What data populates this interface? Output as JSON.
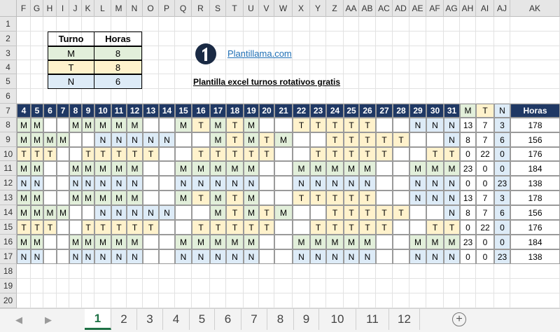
{
  "sheet": {
    "columns": [
      "F",
      "G",
      "H",
      "I",
      "J",
      "K",
      "L",
      "M",
      "N",
      "O",
      "P",
      "Q",
      "R",
      "S",
      "T",
      "U",
      "V",
      "W",
      "X",
      "Y",
      "Z",
      "AA",
      "AB",
      "AC",
      "AD",
      "AE",
      "AF",
      "AG",
      "AH",
      "AI",
      "AJ",
      "AK"
    ],
    "rows": [
      "1",
      "2",
      "3",
      "4",
      "5",
      "6",
      "7",
      "8",
      "9",
      "10",
      "11",
      "12",
      "13",
      "14",
      "15",
      "16",
      "17",
      "18",
      "19",
      "20"
    ]
  },
  "legend": {
    "header": [
      "Turno",
      "Horas"
    ],
    "rows": [
      {
        "turno": "M",
        "horas": "8"
      },
      {
        "turno": "T",
        "horas": "8"
      },
      {
        "turno": "N",
        "horas": "6"
      }
    ]
  },
  "logo_link": "Plantillama.com",
  "title": "Plantilla excel turnos rotativos gratis",
  "table": {
    "days": [
      "4",
      "5",
      "6",
      "7",
      "8",
      "9",
      "10",
      "11",
      "12",
      "13",
      "14",
      "15",
      "16",
      "17",
      "18",
      "19",
      "20",
      "21",
      "22",
      "23",
      "24",
      "25",
      "26",
      "27",
      "28",
      "29",
      "30",
      "31"
    ],
    "summary_headers": [
      "M",
      "T",
      "N",
      "Horas"
    ],
    "rows": [
      {
        "shifts": [
          "M",
          "M",
          "",
          "",
          "M",
          "M",
          "M",
          "M",
          "M",
          "",
          "",
          "M",
          "T",
          "M",
          "T",
          "M",
          "",
          "",
          "T",
          "T",
          "T",
          "T",
          "T",
          "",
          "",
          "N",
          "N",
          "N"
        ],
        "m": "13",
        "t": "7",
        "n": "3",
        "horas": "178"
      },
      {
        "shifts": [
          "M",
          "M",
          "M",
          "M",
          "",
          "",
          "N",
          "N",
          "N",
          "N",
          "N",
          "",
          "",
          "M",
          "T",
          "M",
          "T",
          "M",
          "",
          "",
          "T",
          "T",
          "T",
          "T",
          "T",
          "",
          "",
          "N"
        ],
        "m": "8",
        "t": "7",
        "n": "6",
        "horas": "156"
      },
      {
        "shifts": [
          "T",
          "T",
          "T",
          "",
          "",
          "T",
          "T",
          "T",
          "T",
          "T",
          "",
          "",
          "T",
          "T",
          "T",
          "T",
          "T",
          "",
          "",
          "T",
          "T",
          "T",
          "T",
          "T",
          "",
          "",
          "T",
          "T"
        ],
        "m": "0",
        "t": "22",
        "n": "0",
        "horas": "176"
      },
      {
        "shifts": [
          "M",
          "M",
          "",
          "",
          "M",
          "M",
          "M",
          "M",
          "M",
          "",
          "",
          "M",
          "M",
          "M",
          "M",
          "M",
          "",
          "",
          "M",
          "M",
          "M",
          "M",
          "M",
          "",
          "",
          "M",
          "M",
          "M"
        ],
        "m": "23",
        "t": "0",
        "n": "0",
        "horas": "184"
      },
      {
        "shifts": [
          "N",
          "N",
          "",
          "",
          "N",
          "N",
          "N",
          "N",
          "N",
          "",
          "",
          "N",
          "N",
          "N",
          "N",
          "N",
          "",
          "",
          "N",
          "N",
          "N",
          "N",
          "N",
          "",
          "",
          "N",
          "N",
          "N"
        ],
        "m": "0",
        "t": "0",
        "n": "23",
        "horas": "138"
      },
      {
        "shifts": [
          "M",
          "M",
          "",
          "",
          "M",
          "M",
          "M",
          "M",
          "M",
          "",
          "",
          "M",
          "T",
          "M",
          "T",
          "M",
          "",
          "",
          "T",
          "T",
          "T",
          "T",
          "T",
          "",
          "",
          "N",
          "N",
          "N"
        ],
        "m": "13",
        "t": "7",
        "n": "3",
        "horas": "178"
      },
      {
        "shifts": [
          "M",
          "M",
          "M",
          "M",
          "",
          "",
          "N",
          "N",
          "N",
          "N",
          "N",
          "",
          "",
          "M",
          "T",
          "M",
          "T",
          "M",
          "",
          "",
          "T",
          "T",
          "T",
          "T",
          "T",
          "",
          "",
          "N"
        ],
        "m": "8",
        "t": "7",
        "n": "6",
        "horas": "156"
      },
      {
        "shifts": [
          "T",
          "T",
          "T",
          "",
          "",
          "T",
          "T",
          "T",
          "T",
          "T",
          "",
          "",
          "T",
          "T",
          "T",
          "T",
          "T",
          "",
          "",
          "T",
          "T",
          "T",
          "T",
          "T",
          "",
          "",
          "T",
          "T"
        ],
        "m": "0",
        "t": "22",
        "n": "0",
        "horas": "176"
      },
      {
        "shifts": [
          "M",
          "M",
          "",
          "",
          "M",
          "M",
          "M",
          "M",
          "M",
          "",
          "",
          "M",
          "M",
          "M",
          "M",
          "M",
          "",
          "",
          "M",
          "M",
          "M",
          "M",
          "M",
          "",
          "",
          "M",
          "M",
          "M"
        ],
        "m": "23",
        "t": "0",
        "n": "0",
        "horas": "184"
      },
      {
        "shifts": [
          "N",
          "N",
          "",
          "",
          "N",
          "N",
          "N",
          "N",
          "N",
          "",
          "",
          "N",
          "N",
          "N",
          "N",
          "N",
          "",
          "",
          "N",
          "N",
          "N",
          "N",
          "N",
          "",
          "",
          "N",
          "N",
          "N"
        ],
        "m": "0",
        "t": "0",
        "n": "23",
        "horas": "138"
      }
    ]
  },
  "tabs": [
    "1",
    "2",
    "3",
    "4",
    "5",
    "6",
    "7",
    "8",
    "9",
    "10",
    "11",
    "12"
  ],
  "active_tab": "1",
  "add_sheet_symbol": "+",
  "nav_prev": "◀",
  "nav_next": "▶",
  "colors": {
    "morning": "#e2efda",
    "afternoon": "#fff2cc",
    "night": "#ddebf7",
    "header_navy": "#1f3864",
    "accent_green": "#1e7145"
  }
}
